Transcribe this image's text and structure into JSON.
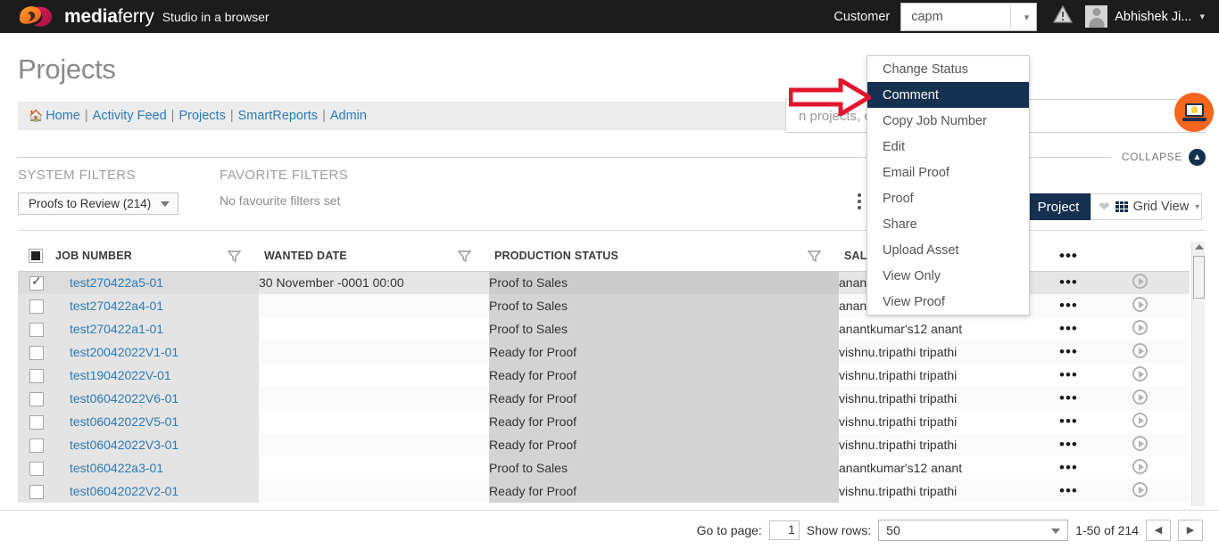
{
  "header": {
    "brand_bold": "media",
    "brand_light": "ferry",
    "tagline": "Studio in a browser",
    "customer_label": "Customer",
    "customer_value": "capm",
    "warning_icon": "warning-triangle-icon",
    "user_name": "Abhishek Ji...",
    "avatar_icon": "user-avatar-icon"
  },
  "page": {
    "title": "Projects"
  },
  "nav": {
    "home_icon": "home-icon",
    "items": [
      {
        "label": "Home"
      },
      {
        "label": "Activity Feed"
      },
      {
        "label": "Projects"
      },
      {
        "label": "SmartReports"
      },
      {
        "label": "Admin"
      }
    ],
    "separator": "|"
  },
  "search": {
    "placeholder": "Search in projects, campaigns, assets",
    "visible_text": "n projects, campaigns, assets",
    "help_badge_icon": "lightbulb-laptop-icon"
  },
  "collapse": {
    "label": "COLLAPSE",
    "icon": "chevron-up-icon"
  },
  "filters": {
    "system_title": "SYSTEM FILTERS",
    "favorite_title": "FAVORITE FILTERS",
    "system_selected": "Proofs to Review (214)",
    "no_favorites": "No favourite filters set",
    "kebab_icon": "vertical-dots-icon"
  },
  "toolbar": {
    "project_button": "Project",
    "gridview_button": "Grid View",
    "heart_icon": "heart-icon",
    "grid_icon": "grid-icon",
    "caret_icon": "chevron-down-icon"
  },
  "context_menu": {
    "items": [
      {
        "label": "Change Status",
        "active": false
      },
      {
        "label": "Comment",
        "active": true
      },
      {
        "label": "Copy Job Number",
        "active": false
      },
      {
        "label": "Edit",
        "active": false
      },
      {
        "label": "Email Proof",
        "active": false
      },
      {
        "label": "Proof",
        "active": false
      },
      {
        "label": "Share",
        "active": false
      },
      {
        "label": "Upload Asset",
        "active": false
      },
      {
        "label": "View Only",
        "active": false
      },
      {
        "label": "View Proof",
        "active": false
      }
    ],
    "annotation_icon": "red-arrow-icon"
  },
  "table": {
    "columns": [
      {
        "label": "JOB NUMBER",
        "filter_icon": "funnel-icon"
      },
      {
        "label": "WANTED DATE",
        "filter_icon": "funnel-icon"
      },
      {
        "label": "PRODUCTION STATUS",
        "filter_icon": "funnel-icon"
      },
      {
        "label": "SALES RE",
        "filter_icon": "funnel-icon"
      }
    ],
    "header_checkbox_state": "indeterminate",
    "row_dots_icon": "horizontal-dots-icon",
    "row_play_icon": "play-circle-icon",
    "rows": [
      {
        "selected": true,
        "job": "test270422a5-01",
        "wanted": "30 November -0001 00:00",
        "status": "Proof to Sales",
        "sales": "anantku",
        "dots": "•••"
      },
      {
        "selected": false,
        "job": "test270422a4-01",
        "wanted": "",
        "status": "Proof to Sales",
        "sales": "anantkumar's12 anant",
        "dots": "•••"
      },
      {
        "selected": false,
        "job": "test270422a1-01",
        "wanted": "",
        "status": "Proof to Sales",
        "sales": "anantkumar's12 anant",
        "dots": "•••"
      },
      {
        "selected": false,
        "job": "test20042022V1-01",
        "wanted": "",
        "status": "Ready for Proof",
        "sales": "vishnu.tripathi tripathi",
        "dots": "•••"
      },
      {
        "selected": false,
        "job": "test19042022V-01",
        "wanted": "",
        "status": "Ready for Proof",
        "sales": "vishnu.tripathi tripathi",
        "dots": "•••"
      },
      {
        "selected": false,
        "job": "test06042022V6-01",
        "wanted": "",
        "status": "Ready for Proof",
        "sales": "vishnu.tripathi tripathi",
        "dots": "•••"
      },
      {
        "selected": false,
        "job": "test06042022V5-01",
        "wanted": "",
        "status": "Ready for Proof",
        "sales": "vishnu.tripathi tripathi",
        "dots": "•••"
      },
      {
        "selected": false,
        "job": "test06042022V3-01",
        "wanted": "",
        "status": "Ready for Proof",
        "sales": "vishnu.tripathi tripathi",
        "dots": "•••"
      },
      {
        "selected": false,
        "job": "test060422a3-01",
        "wanted": "",
        "status": "Proof to Sales",
        "sales": "anantkumar's12 anant",
        "dots": "•••"
      },
      {
        "selected": false,
        "job": "test06042022V2-01",
        "wanted": "",
        "status": "Ready for Proof",
        "sales": "vishnu.tripathi tripathi",
        "dots": "•••"
      }
    ]
  },
  "scrollbar": {
    "up_icon": "scroll-up-arrow-icon",
    "thumb": "scroll-thumb"
  },
  "footer": {
    "goto_label": "Go to page:",
    "page_value": "1",
    "showrows_label": "Show rows:",
    "rows_value": "50",
    "range_text": "1-50 of 214",
    "prev_icon": "◀",
    "next_icon": "▶"
  },
  "colors": {
    "topbar": "#1c1c1c",
    "accent_navy": "#16304f",
    "link_blue": "#2b7bb9",
    "orange_badge": "#f4661e",
    "annotation_red": "#e2142d"
  }
}
